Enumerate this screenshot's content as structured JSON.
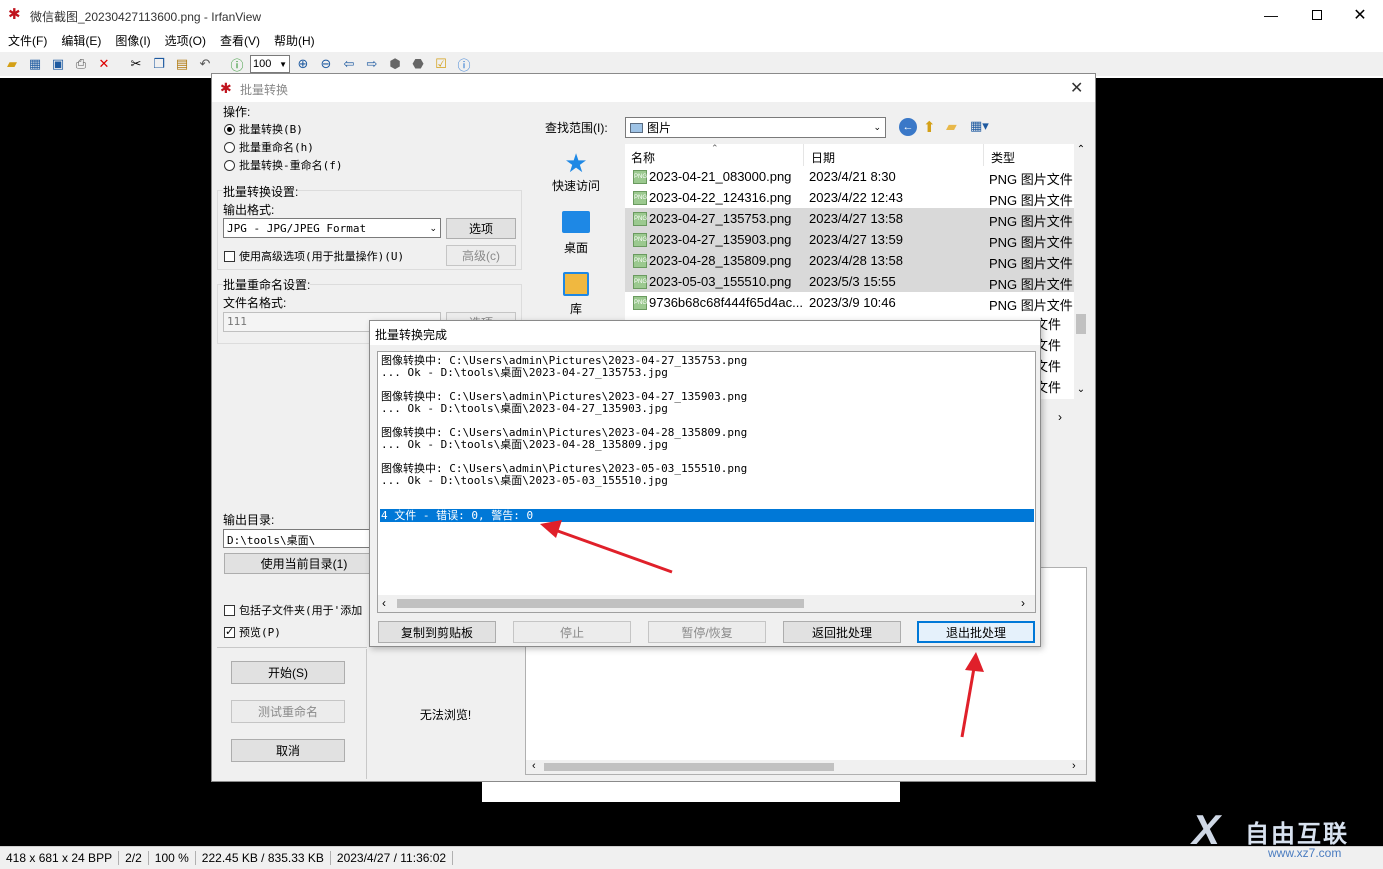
{
  "window": {
    "title": "微信截图_20230427113600.png - IrfanView",
    "menu": [
      "文件(F)",
      "编辑(E)",
      "图像(I)",
      "选项(O)",
      "查看(V)",
      "帮助(H)"
    ],
    "zoom_value": "100"
  },
  "status_bar": {
    "dimensions": "418 x 681 x 24 BPP",
    "index": "2/2",
    "zoom": "100 %",
    "size": "222.45 KB / 835.33 KB",
    "date": "2023/4/27 / 11:36:02"
  },
  "batch": {
    "title": "批量转换",
    "operation_label": "操作:",
    "op_convert": "批量转换(B)",
    "op_rename": "批量重命名(h)",
    "op_both": "批量转换-重命名(f)",
    "convert_settings": "批量转换设置:",
    "output_format_label": "输出格式:",
    "output_format": "JPG - JPG/JPEG Format",
    "options_button": "选项",
    "advanced_check": "使用高级选项(用于批量操作)(U)",
    "advanced_button": "高级(c)",
    "rename_settings": "批量重命名设置:",
    "filename_format_label": "文件名格式:",
    "filename_format": "111",
    "rename_options_button": "选项",
    "output_dir_label": "输出目录:",
    "output_dir": "D:\\tools\\桌面\\",
    "use_current_dir": "使用当前目录(1)",
    "include_subfolders": "包括子文件夹(用于'添加",
    "preview_check": "预览(P)",
    "start_button": "开始(S)",
    "test_rename_button": "测试重命名",
    "cancel_button": "取消",
    "no_preview": "无法浏览!",
    "look_in_label": "查找范围(I):",
    "look_in_value": "图片",
    "places": [
      "快速访问",
      "桌面",
      "库"
    ],
    "columns": [
      "名称",
      "日期",
      "类型"
    ],
    "files": [
      {
        "name": "2023-04-21_083000.png",
        "date": "2023/4/21 8:30",
        "type": "PNG 图片文件",
        "selected": false
      },
      {
        "name": "2023-04-22_124316.png",
        "date": "2023/4/22 12:43",
        "type": "PNG 图片文件",
        "selected": false
      },
      {
        "name": "2023-04-27_135753.png",
        "date": "2023/4/27 13:58",
        "type": "PNG 图片文件",
        "selected": true
      },
      {
        "name": "2023-04-27_135903.png",
        "date": "2023/4/27 13:59",
        "type": "PNG 图片文件",
        "selected": true
      },
      {
        "name": "2023-04-28_135809.png",
        "date": "2023/4/28 13:58",
        "type": "PNG 图片文件",
        "selected": true
      },
      {
        "name": "2023-05-03_155510.png",
        "date": "2023/5/3 15:55",
        "type": "PNG 图片文件",
        "selected": true
      },
      {
        "name": "9736b68c68f444f65d4ac...",
        "date": "2023/3/9 10:46",
        "type": "PNG 图片文件",
        "selected": false
      }
    ],
    "extra_types": [
      "文件",
      "文件",
      "文件",
      "文件",
      "文件"
    ]
  },
  "done_dialog": {
    "title": "批量转换完成",
    "log": [
      "图像转换中: C:\\Users\\admin\\Pictures\\2023-04-27_135753.png",
      "... Ok - D:\\tools\\桌面\\2023-04-27_135753.jpg",
      "",
      "图像转换中: C:\\Users\\admin\\Pictures\\2023-04-27_135903.png",
      "... Ok - D:\\tools\\桌面\\2023-04-27_135903.jpg",
      "",
      "图像转换中: C:\\Users\\admin\\Pictures\\2023-04-28_135809.png",
      "... Ok - D:\\tools\\桌面\\2023-04-28_135809.jpg",
      "",
      "图像转换中: C:\\Users\\admin\\Pictures\\2023-05-03_155510.png",
      "... Ok - D:\\tools\\桌面\\2023-05-03_155510.jpg"
    ],
    "summary": "4 文件 - 错误: 0, 警告: 0",
    "buttons": {
      "copy": "复制到剪贴板",
      "stop": "停止",
      "pause": "暂停/恢复",
      "back": "返回批处理",
      "exit": "退出批处理"
    }
  },
  "watermark": {
    "brand": "自由互联",
    "url": "www.xz7.com"
  },
  "colors": {
    "selection": "#0078d7",
    "annotation": "#e0202a",
    "accent": "#0078d7"
  }
}
